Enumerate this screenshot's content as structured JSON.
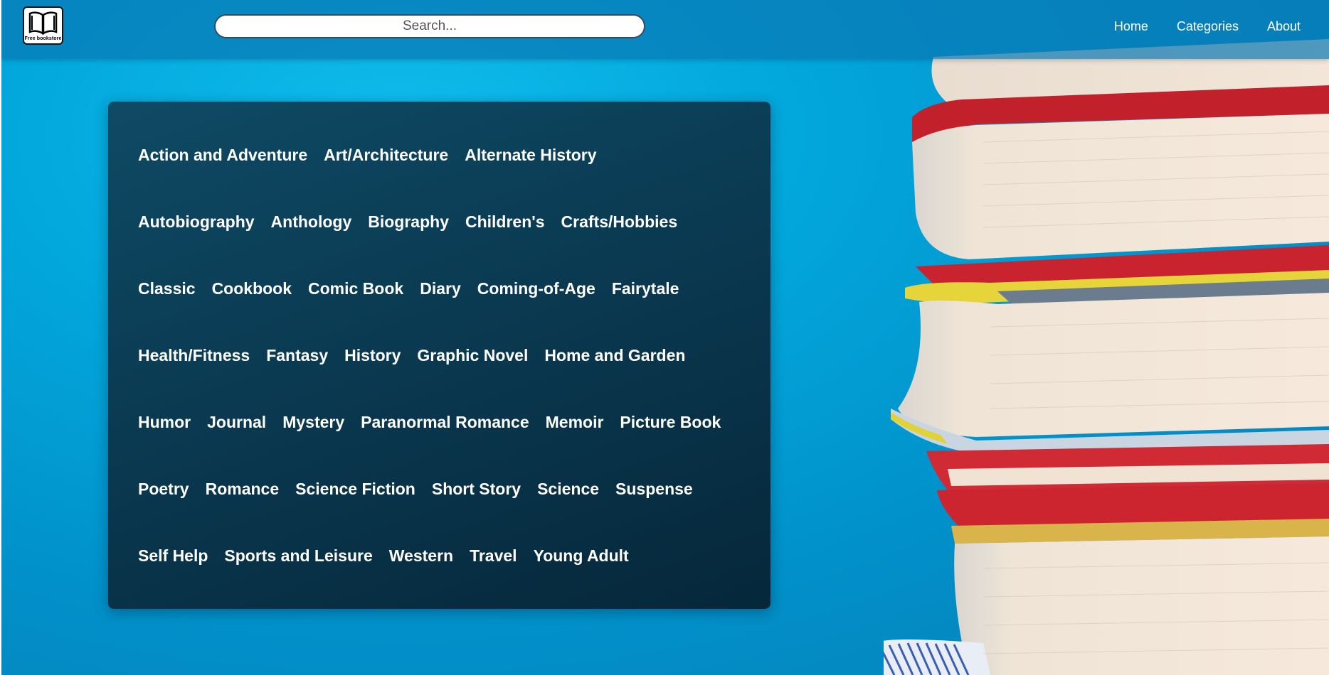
{
  "header": {
    "logo_text": "Free bookstore",
    "search_placeholder": "Search...",
    "nav": [
      "Home",
      "Categories",
      "About"
    ]
  },
  "categories": [
    [
      "Action and Adventure",
      "Art/Architecture",
      "Alternate History"
    ],
    [
      "Autobiography",
      "Anthology",
      "Biography",
      "Children's",
      "Crafts/Hobbies"
    ],
    [
      "Classic",
      "Cookbook",
      "Comic Book",
      "Diary",
      "Coming-of-Age",
      "Fairytale"
    ],
    [
      "Health/Fitness",
      "Fantasy",
      "History",
      "Graphic Novel",
      "Home and Garden"
    ],
    [
      "Humor",
      "Journal",
      "Mystery",
      "Paranormal Romance",
      "Memoir",
      "Picture Book"
    ],
    [
      "Poetry",
      "Romance",
      "Science Fiction",
      "Short Story",
      "Science",
      "Suspense"
    ],
    [
      "Self Help",
      "Sports and Leisure",
      "Western",
      "Travel",
      "Young Adult"
    ]
  ],
  "colors": {
    "background": "#02a7dc",
    "header": "#0878b4",
    "panel": "#0a3a52",
    "text": "#ffffff"
  }
}
